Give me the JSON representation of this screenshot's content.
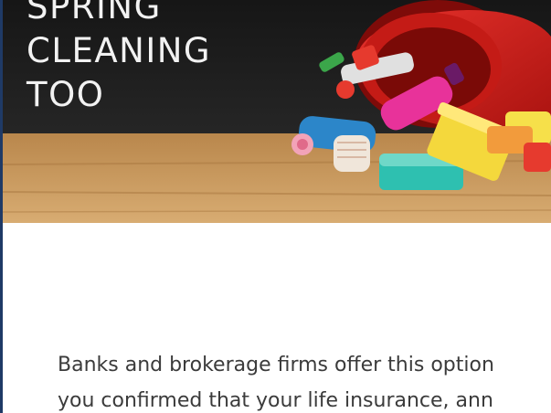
{
  "hero": {
    "title_lines": [
      "SPRING",
      "CLEANING",
      "TOO"
    ],
    "image_icon": "cleaning-bucket-image"
  },
  "article": {
    "lines": [
      "Banks and brokerage firms offer this option",
      "you confirmed that your life insurance, ann"
    ]
  },
  "colors": {
    "accent_rule": "#1f3a66",
    "chalkboard": "#1c1c1c",
    "wood": "#c99a5e",
    "text": "#3b3b3b"
  }
}
